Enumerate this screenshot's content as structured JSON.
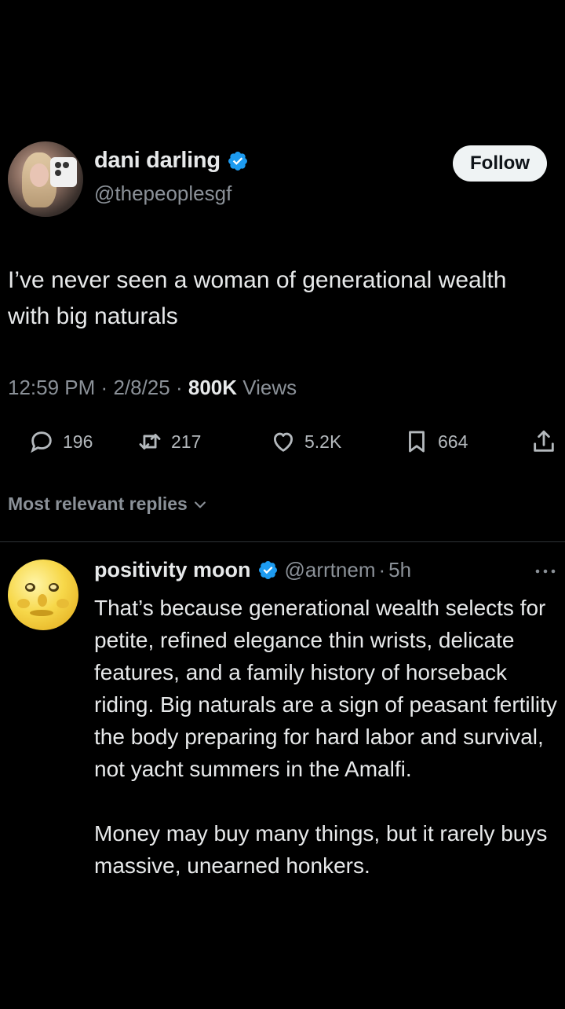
{
  "tweet": {
    "author_name": "dani darling",
    "author_handle": "@thepeoplesgf",
    "follow_label": "Follow",
    "text": "I’ve never seen a woman of generational wealth with big naturals",
    "time": "12:59 PM",
    "date": "2/8/25",
    "views_count": "800K",
    "views_label": "Views",
    "separator": "·"
  },
  "actions": {
    "replies": "196",
    "retweets": "217",
    "likes": "5.2K",
    "bookmarks": "664"
  },
  "replies_section": {
    "label": "Most relevant replies"
  },
  "reply": {
    "author_name": "positivity moon",
    "author_handle": "@arrtnem",
    "time": "5h",
    "separator": "·",
    "paragraph1": "That’s because generational wealth selects for petite, refined elegance thin wrists, delicate features, and a family history of horseback riding. Big naturals are a sign of peasant fertility the body preparing for hard labor and survival, not yacht summers in the Amalfi.",
    "paragraph2": "Money may buy many things, but it rarely buys massive, unearned honkers."
  },
  "colors": {
    "background": "#000000",
    "text": "#e7e9ea",
    "secondary_text": "#8b9198",
    "verified_blue": "#1d9bf0",
    "divider": "#2f3336"
  },
  "icons": {
    "verified": "verified-badge-icon",
    "reply": "reply-icon",
    "retweet": "retweet-icon",
    "like": "heart-icon",
    "bookmark": "bookmark-icon",
    "share": "share-icon",
    "dropdown": "chevron-down-icon",
    "more": "more-icon"
  }
}
